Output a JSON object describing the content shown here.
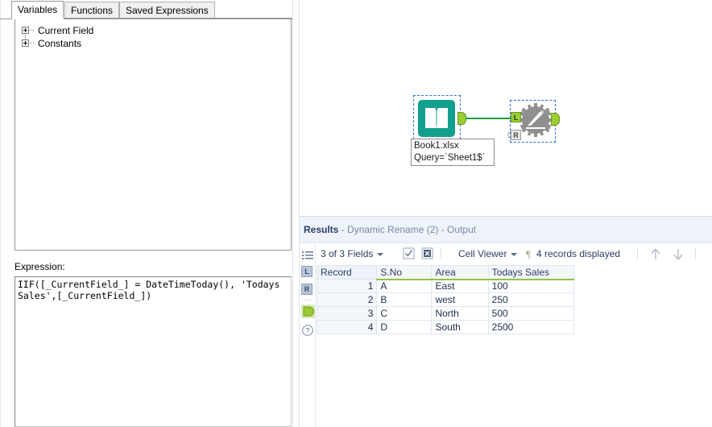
{
  "left_panel": {
    "tabs": [
      {
        "label": "Variables",
        "active": true
      },
      {
        "label": "Functions",
        "active": false
      },
      {
        "label": "Saved Expressions",
        "active": false
      }
    ],
    "tree": [
      {
        "label": "Current Field",
        "expander": "plus-icon"
      },
      {
        "label": "Constants",
        "expander": "plus-icon"
      }
    ],
    "expression_label": "Expression:",
    "expression_value": "IIF([_CurrentField_] = DateTimeToday(), 'Todays Sales',[_CurrentField_])"
  },
  "canvas": {
    "tools": [
      {
        "name": "input-data-tool",
        "icon": "open-book-icon",
        "icon_color": "#12a08e",
        "selected": true,
        "annotation_line1": "Book1.xlsx",
        "annotation_line2": "Query=`Sheet1$`",
        "output_anchor": "output-anchor"
      },
      {
        "name": "dynamic-rename-tool",
        "icon": "gear-pencil-icon",
        "icon_color": "#8a8a8a",
        "selected": true,
        "input_anchor_left": "L",
        "input_anchor_right": "R",
        "output_anchor": "output-anchor"
      }
    ],
    "connection_color": "#1d9b38"
  },
  "results": {
    "title_main": "Results",
    "title_sub": " - Dynamic Rename (2) - Output",
    "rail": [
      {
        "name": "field-list-icon",
        "label": ""
      },
      {
        "name": "input-anchor-L",
        "label": "L"
      },
      {
        "name": "input-anchor-R",
        "label": "R"
      },
      {
        "name": "output-anchor",
        "label": ""
      },
      {
        "name": "help-icon",
        "label": "?"
      }
    ],
    "toolbar": {
      "fields_label": "3 of 3 Fields",
      "select_all_icon": "checkbox-checked-icon",
      "deselect_all_icon": "checkbox-x-icon",
      "cell_viewer_label": "Cell Viewer",
      "pilcrow_icon": "pilcrow-icon",
      "records_label": "4 records displayed",
      "nav_up_icon": "arrow-up-icon",
      "nav_down_icon": "arrow-down-icon"
    },
    "grid": {
      "columns": [
        "Record",
        "S.No",
        "Area",
        "Todays Sales"
      ],
      "rows": [
        {
          "record": "1",
          "sno": "A",
          "area": "East",
          "sales": "100"
        },
        {
          "record": "2",
          "sno": "B",
          "area": "west",
          "sales": "250"
        },
        {
          "record": "3",
          "sno": "C",
          "area": "North",
          "sales": "500"
        },
        {
          "record": "4",
          "sno": "D",
          "area": "South",
          "sales": "2500"
        }
      ]
    }
  },
  "colors": {
    "accent_green": "#8dc63f",
    "tool_teal": "#12a08e",
    "connector_green": "#1d9b38",
    "header_blue": "#2c3e66",
    "panel_bg": "#eef2f9"
  }
}
